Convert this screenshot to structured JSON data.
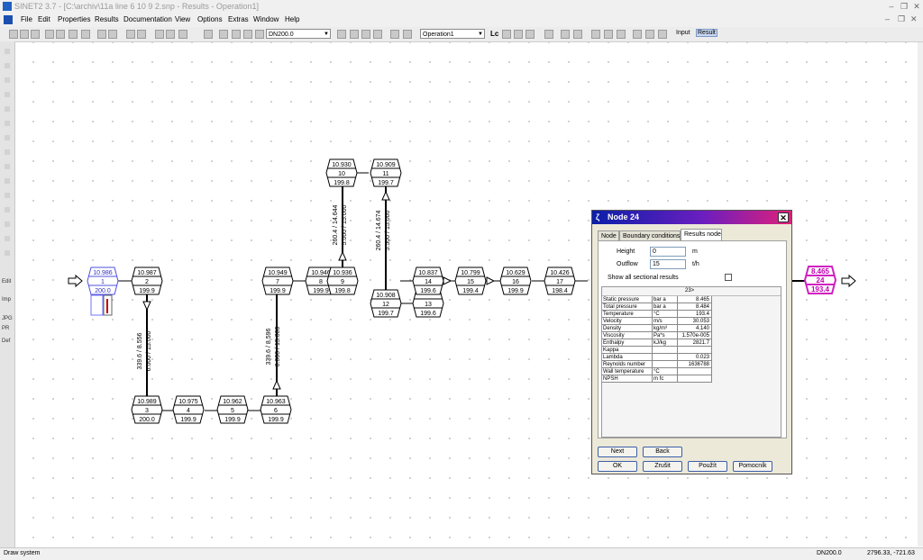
{
  "window": {
    "title": "SINET2 3.7 - [C:\\archiv\\11a line 6 10 9 2.snp - Results - Operation1]"
  },
  "menu": [
    "File",
    "Edit",
    "Properties",
    "Results",
    "Documentation",
    "View",
    "Options",
    "Extras",
    "Window",
    "Help"
  ],
  "toolbar": {
    "dn_select": "DN200.0",
    "operation_select": "Operation1",
    "lc_label": "Lc",
    "input_label": "Input",
    "result_label": "Result"
  },
  "left_toolbar": [
    "Edit",
    "Imp",
    "JPG",
    "PR",
    "Def"
  ],
  "nodes": [
    {
      "id": "1",
      "top": "10.986",
      "bot": "200.0",
      "style": "blue"
    },
    {
      "id": "2",
      "top": "10.987",
      "bot": "199.9"
    },
    {
      "id": "3",
      "top": "10.989",
      "bot": "200.0"
    },
    {
      "id": "4",
      "top": "10.975",
      "bot": "199.9"
    },
    {
      "id": "5",
      "top": "10.962",
      "bot": "199.9"
    },
    {
      "id": "6",
      "top": "10.963",
      "bot": "199.9"
    },
    {
      "id": "7",
      "top": "10.949",
      "bot": "199.9"
    },
    {
      "id": "8",
      "top": "10.946",
      "bot": "199.9"
    },
    {
      "id": "9",
      "top": "10.936",
      "bot": "199.8"
    },
    {
      "id": "10",
      "top": "10.930",
      "bot": "199.8"
    },
    {
      "id": "11",
      "top": "10.909",
      "bot": "199.7"
    },
    {
      "id": "12",
      "top": "10.908",
      "bot": "199.7"
    },
    {
      "id": "13",
      "top": "",
      "bot": "199.6"
    },
    {
      "id": "14",
      "top": "10.837",
      "bot": "199.6"
    },
    {
      "id": "15",
      "top": "10.799",
      "bot": "199.4"
    },
    {
      "id": "16",
      "top": "10.629",
      "bot": "199.9"
    },
    {
      "id": "17",
      "top": "10.426",
      "bot": "198.4"
    },
    {
      "id": "24",
      "top": "8.465",
      "bot": "193.4",
      "style": "magenta"
    }
  ],
  "pipe_labels": [
    {
      "id": "2-3",
      "a": "339.6 / 8.556",
      "b": "6.000 / 15.000"
    },
    {
      "id": "6-7",
      "a": "339.6 / 8.596",
      "b": "6.000 / 15.000"
    },
    {
      "id": "8-10",
      "a": "260.4 / 14.644",
      "b": "5.000 / 15.000"
    },
    {
      "id": "9-12",
      "a": "260.4 / 14.674",
      "b": "5.500 / 15.000"
    }
  ],
  "dialog": {
    "title": "Node 24",
    "tabs": [
      "Node",
      "Boundary conditions",
      "Results node"
    ],
    "height_label": "Height",
    "height_value": "0",
    "height_unit": "m",
    "outflow_label": "Outflow",
    "outflow_value": "15",
    "outflow_unit": "t/h",
    "show_all_label": "Show all sectional results",
    "column_header": "23>",
    "rows": [
      {
        "name": "Static pressure",
        "unit": "bar a",
        "value": "8.465"
      },
      {
        "name": "Total pressure",
        "unit": "bar a",
        "value": "8.484"
      },
      {
        "name": "Temperature",
        "unit": "°C",
        "value": "193.4"
      },
      {
        "name": "Velocity",
        "unit": "m/s",
        "value": "30.053"
      },
      {
        "name": "Density",
        "unit": "kg/m³",
        "value": "4.140"
      },
      {
        "name": "Viscosity",
        "unit": "Pa*s",
        "value": "1.570e-005"
      },
      {
        "name": "Enthalpy",
        "unit": "kJ/kg",
        "value": "2821.7"
      },
      {
        "name": "Kappa",
        "unit": "",
        "value": ""
      },
      {
        "name": "Lambda",
        "unit": "",
        "value": "0.023"
      },
      {
        "name": "Reynolds number",
        "unit": "",
        "value": "1636788"
      },
      {
        "name": "Wall temperature",
        "unit": "°C",
        "value": ""
      },
      {
        "name": "NPSH",
        "unit": "m fc",
        "value": ""
      }
    ],
    "buttons": {
      "next": "Next",
      "back": "Back",
      "ok": "OK",
      "cancel": "Zrušit",
      "apply": "Použít",
      "help": "Pomocník"
    }
  },
  "status": {
    "left": "Draw system",
    "dn": "DN200.0",
    "coords": "2796.33, -721.63"
  }
}
